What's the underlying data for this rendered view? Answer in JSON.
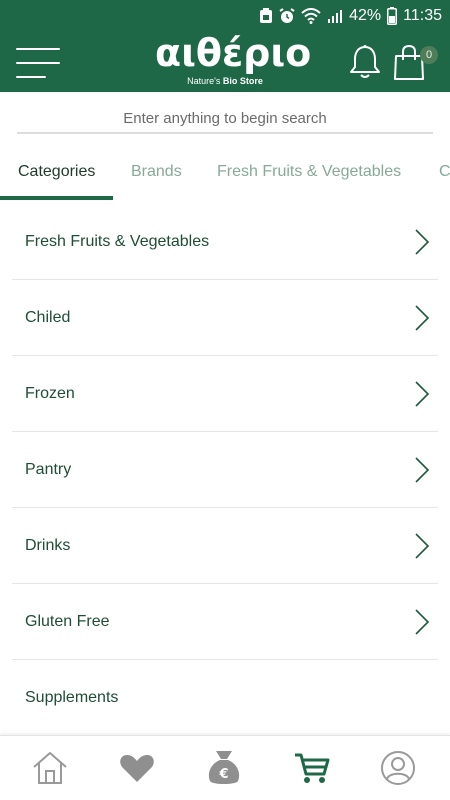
{
  "status_bar": {
    "battery_percent": "42%",
    "time": "11:35",
    "icons": [
      "nfc-icon",
      "alarm-icon",
      "wifi-icon",
      "signal-icon",
      "battery-icon"
    ]
  },
  "header": {
    "logo_text": "αιθέριο",
    "logo_tagline_prefix": "Nature's",
    "logo_tagline_bold": "Bio Store",
    "cart_count": "0",
    "colors": {
      "brand_green": "#1e6848",
      "badge_green": "#4f7d57"
    }
  },
  "search": {
    "placeholder": "Enter anything to begin search",
    "value": ""
  },
  "tabs": [
    {
      "label": "Categories",
      "active": true
    },
    {
      "label": "Brands",
      "active": false
    },
    {
      "label": "Fresh Fruits & Vegetables",
      "active": false
    },
    {
      "label": "C",
      "active": false
    }
  ],
  "categories": [
    {
      "label": "Fresh Fruits & Vegetables"
    },
    {
      "label": "Chiled"
    },
    {
      "label": "Frozen"
    },
    {
      "label": "Pantry"
    },
    {
      "label": "Drinks"
    },
    {
      "label": "Gluten Free"
    },
    {
      "label": "Supplements"
    }
  ],
  "bottom_nav": [
    {
      "icon": "home-icon",
      "active": false
    },
    {
      "icon": "heart-icon",
      "active": false
    },
    {
      "icon": "money-bag-euro-icon",
      "active": false
    },
    {
      "icon": "cart-icon",
      "active": true
    },
    {
      "icon": "user-icon",
      "active": false
    }
  ]
}
